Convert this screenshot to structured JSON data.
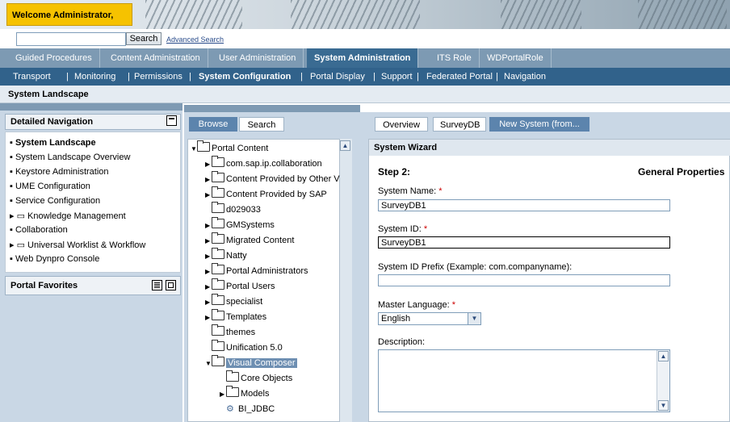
{
  "header": {
    "welcome": "Welcome Administrator,"
  },
  "search": {
    "button": "Search",
    "advanced": "Advanced Search"
  },
  "nav1": {
    "items": [
      "Guided Procedures",
      "Content Administration",
      "User Administration",
      "System Administration",
      "ITS Role",
      "WDPortalRole"
    ]
  },
  "nav2": {
    "items": [
      "Transport",
      "Monitoring",
      "Permissions",
      "System Configuration",
      "Portal Display",
      "Support",
      "Federated Portal",
      "Navigation"
    ]
  },
  "page": {
    "title": "System Landscape"
  },
  "left": {
    "detailed_nav": "Detailed Navigation",
    "items": [
      "System Landscape",
      "System Landscape Overview",
      "Keystore Administration",
      "UME Configuration",
      "Service Configuration",
      "Knowledge Management",
      "Collaboration",
      "Universal Worklist & Workflow",
      "Web Dynpro Console"
    ],
    "portal_favorites": "Portal Favorites"
  },
  "middle": {
    "tabs": [
      "Browse",
      "Search"
    ],
    "tree": [
      "Portal Content",
      "com.sap.ip.collaboration",
      "Content Provided by Other V",
      "Content Provided by SAP",
      "d029033",
      "GMSystems",
      "Migrated Content",
      "Natty",
      "Portal Administrators",
      "Portal Users",
      "specialist",
      "Templates",
      "themes",
      "Unification 5.0",
      "Visual Composer",
      "Core Objects",
      "Models",
      "BI_JDBC"
    ]
  },
  "right": {
    "tabs": [
      "Overview",
      "SurveyDB",
      "New System (from..."
    ],
    "wizard_title": "System Wizard",
    "step": "Step 2:",
    "section": "General Properties",
    "system_name_label": "System Name:",
    "system_name": "SurveyDB1",
    "system_id_label": "System ID:",
    "system_id": "SurveyDB1",
    "prefix_label": "System ID Prefix (Example: com.companyname):",
    "prefix": "",
    "master_lang_label": "Master Language:",
    "master_lang": "English",
    "description_label": "Description:",
    "required_mark": "*"
  }
}
